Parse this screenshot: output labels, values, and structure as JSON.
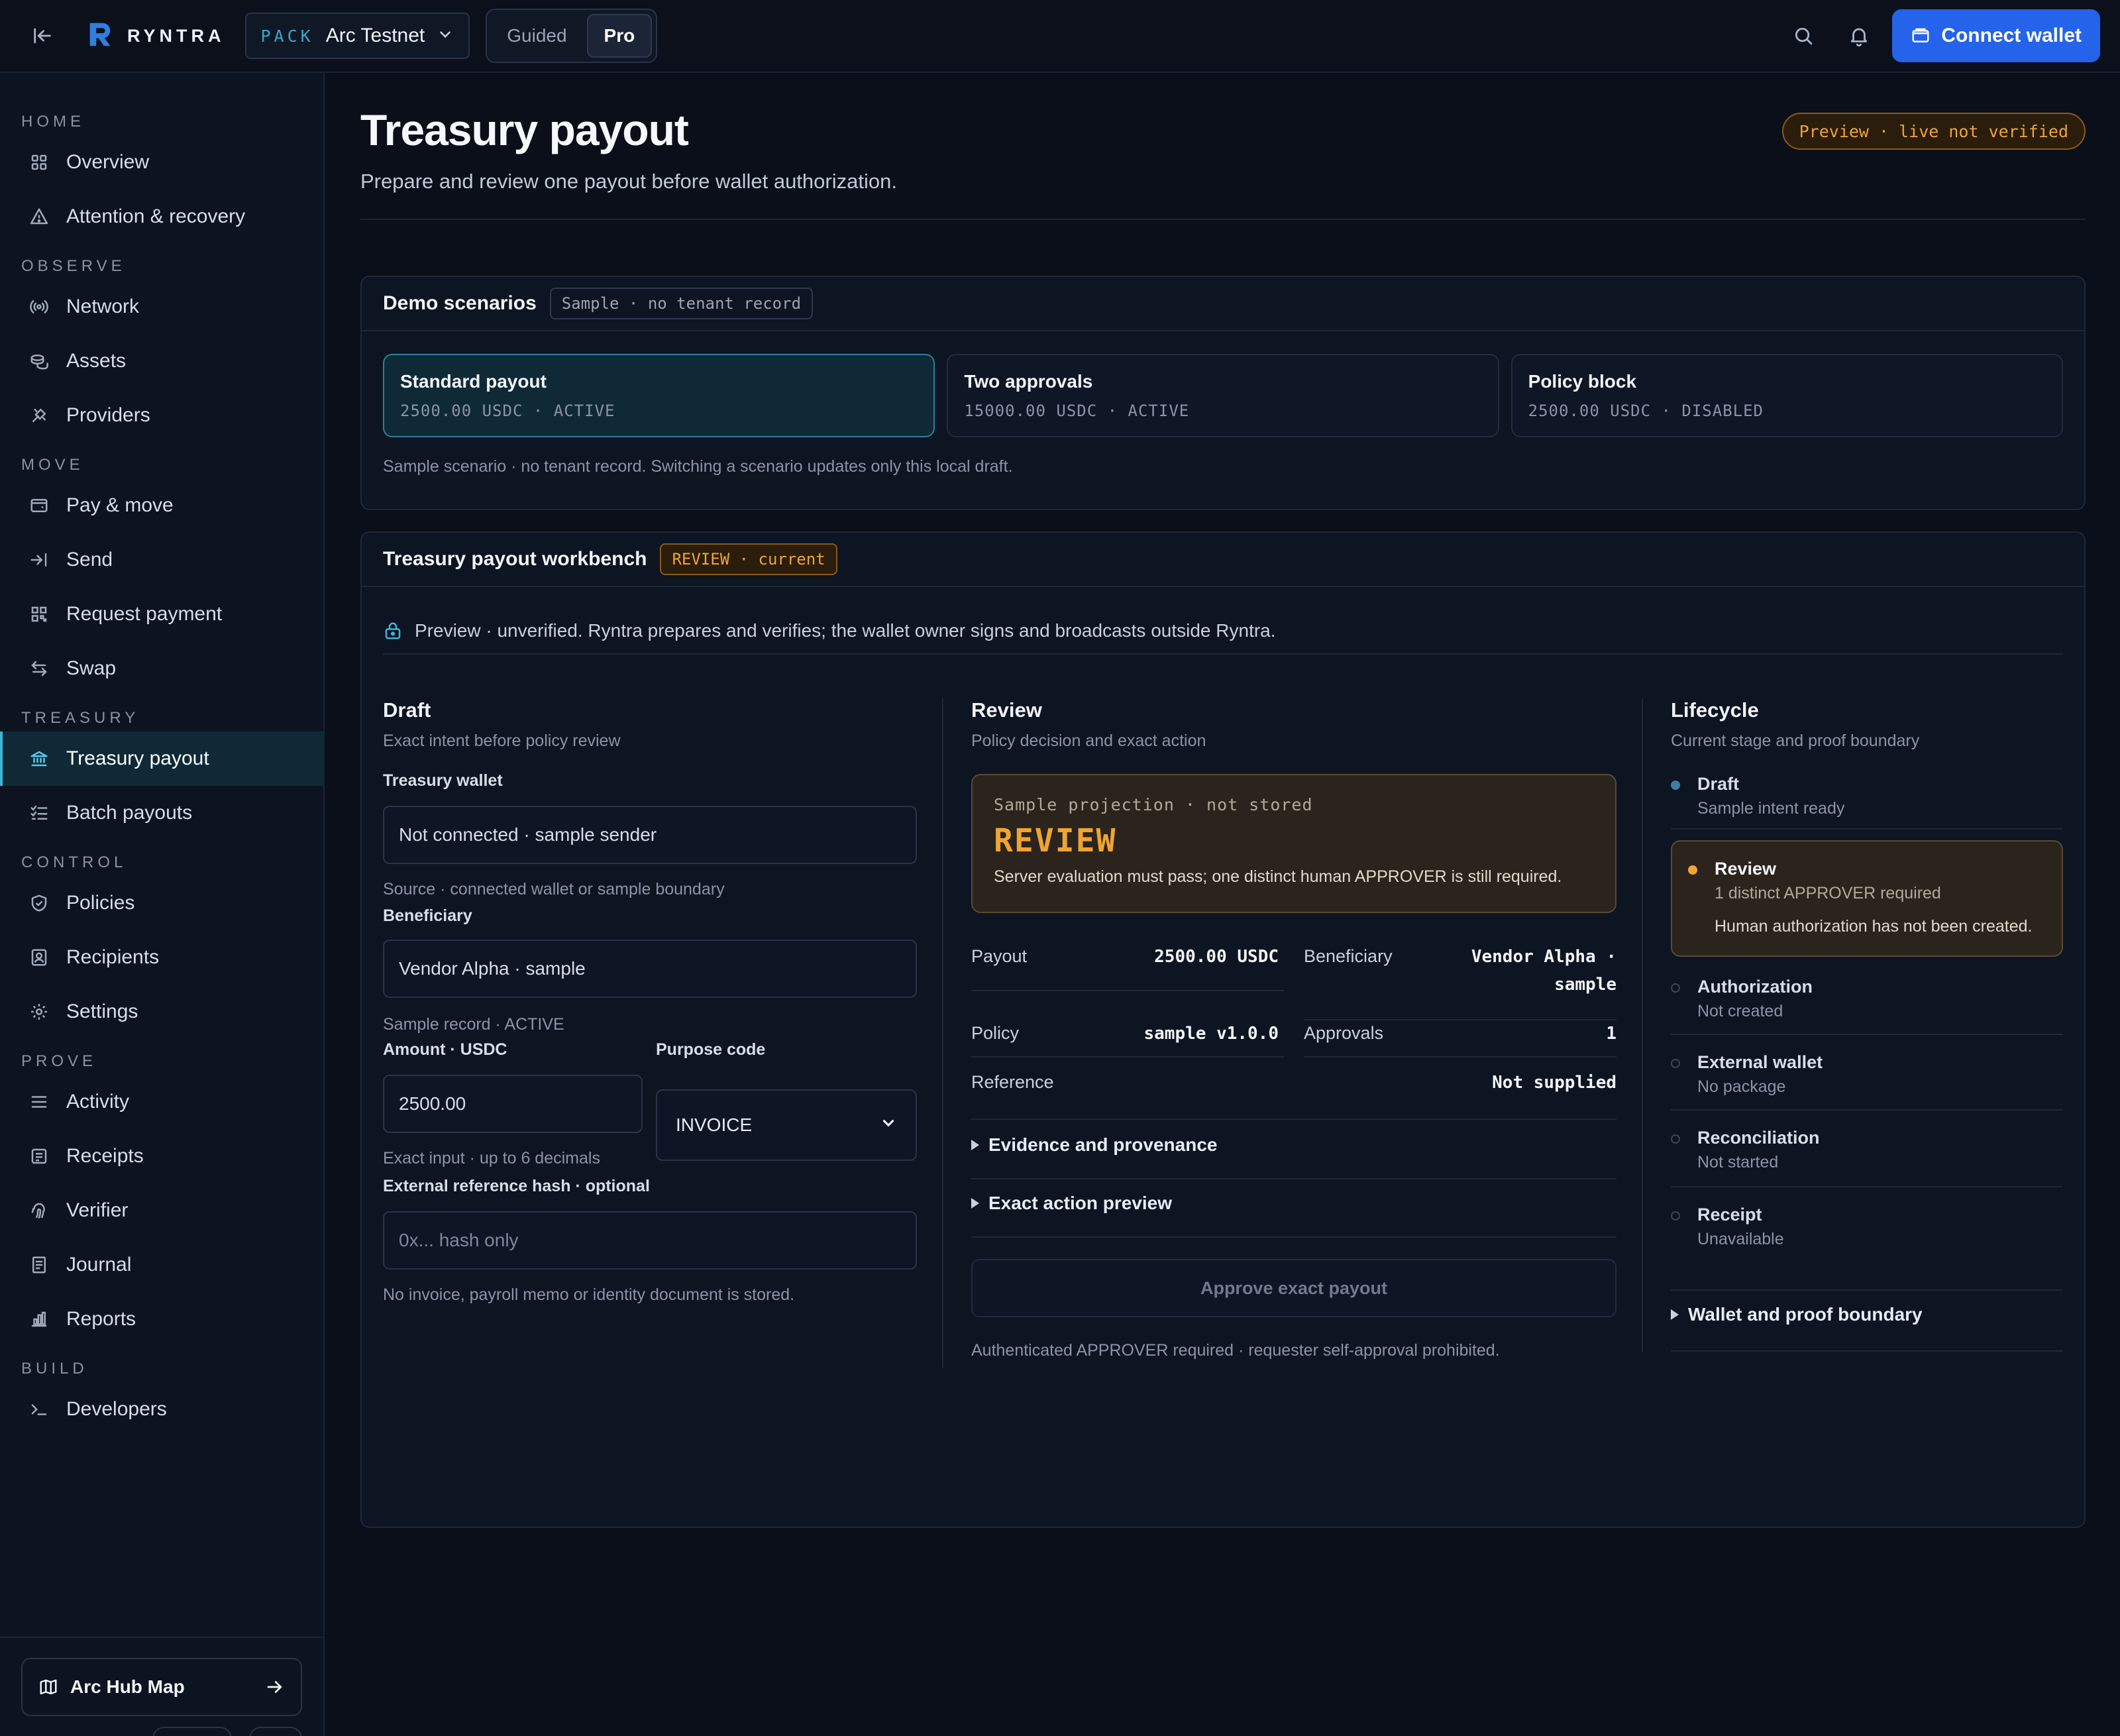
{
  "topbar": {
    "brand": "RYNTRA",
    "pack_tag": "PACK",
    "network": "Arc Testnet",
    "modes": [
      "Guided",
      "Pro"
    ],
    "active_mode": "Pro",
    "connect_label": "Connect wallet"
  },
  "sidebar": {
    "sections": [
      {
        "label": "HOME",
        "items": [
          {
            "label": "Overview",
            "icon": "grid-icon"
          },
          {
            "label": "Attention & recovery",
            "icon": "warning-icon"
          }
        ]
      },
      {
        "label": "OBSERVE",
        "items": [
          {
            "label": "Network",
            "icon": "broadcast-icon"
          },
          {
            "label": "Assets",
            "icon": "coins-icon"
          },
          {
            "label": "Providers",
            "icon": "plug-icon"
          }
        ]
      },
      {
        "label": "MOVE",
        "items": [
          {
            "label": "Pay & move",
            "icon": "wallet-icon"
          },
          {
            "label": "Send",
            "icon": "send-icon"
          },
          {
            "label": "Request payment",
            "icon": "qr-icon"
          },
          {
            "label": "Swap",
            "icon": "swap-icon"
          }
        ]
      },
      {
        "label": "TREASURY",
        "items": [
          {
            "label": "Treasury payout",
            "icon": "bank-icon",
            "active": true
          },
          {
            "label": "Batch payouts",
            "icon": "list-check-icon"
          }
        ]
      },
      {
        "label": "CONTROL",
        "items": [
          {
            "label": "Policies",
            "icon": "shield-icon"
          },
          {
            "label": "Recipients",
            "icon": "contact-icon"
          },
          {
            "label": "Settings",
            "icon": "gear-icon"
          }
        ]
      },
      {
        "label": "PROVE",
        "items": [
          {
            "label": "Activity",
            "icon": "menu-icon"
          },
          {
            "label": "Receipts",
            "icon": "receipt-icon"
          },
          {
            "label": "Verifier",
            "icon": "fingerprint-icon"
          },
          {
            "label": "Journal",
            "icon": "journal-icon"
          },
          {
            "label": "Reports",
            "icon": "chart-icon"
          }
        ]
      },
      {
        "label": "BUILD",
        "items": [
          {
            "label": "Developers",
            "icon": "terminal-icon"
          }
        ]
      }
    ],
    "hub_map": "Arc Hub Map"
  },
  "page": {
    "title": "Treasury payout",
    "subtitle": "Prepare and review one payout before wallet authorization.",
    "preview_badge": "Preview · live not verified"
  },
  "scenarios": {
    "title": "Demo scenarios",
    "chip": "Sample · no tenant record",
    "cards": [
      {
        "name": "Standard payout",
        "meta": "2500.00 USDC · ACTIVE",
        "active": true
      },
      {
        "name": "Two approvals",
        "meta": "15000.00 USDC · ACTIVE"
      },
      {
        "name": "Policy block",
        "meta": "2500.00 USDC · DISABLED"
      }
    ],
    "note": "Sample scenario · no tenant record. Switching a scenario updates only this local draft."
  },
  "workbench": {
    "title": "Treasury payout workbench",
    "chip": "REVIEW · current",
    "banner": "Preview · unverified. Ryntra prepares and verifies; the wallet owner signs and broadcasts outside Ryntra."
  },
  "draft": {
    "title": "Draft",
    "subtitle": "Exact intent before policy review",
    "wallet_label": "Treasury wallet",
    "wallet_value": "Not connected · sample sender",
    "wallet_help": "Source · connected wallet or sample boundary",
    "beneficiary_label": "Beneficiary",
    "beneficiary_value": "Vendor Alpha · sample",
    "beneficiary_help": "Sample record · ACTIVE",
    "amount_label": "Amount · USDC",
    "amount_value": "2500.00",
    "amount_help": "Exact input · up to 6 decimals",
    "purpose_label": "Purpose code",
    "purpose_value": "INVOICE",
    "ref_label": "External reference hash · optional",
    "ref_placeholder": "0x... hash only",
    "ref_help": "No invoice, payroll memo or identity document is stored."
  },
  "review": {
    "title": "Review",
    "subtitle": "Policy decision and exact action",
    "proj_label": "Sample projection · not stored",
    "proj_value": "REVIEW",
    "proj_desc": "Server evaluation must pass; one distinct human APPROVER is still required.",
    "payout_label": "Payout",
    "payout_value": "2500.00 USDC",
    "beneficiary_label": "Beneficiary",
    "beneficiary_value_1": "Vendor Alpha ·",
    "beneficiary_value_2": "sample",
    "policy_label": "Policy",
    "policy_value": "sample v1.0.0",
    "approvals_label": "Approvals",
    "approvals_value": "1",
    "reference_label": "Reference",
    "reference_value": "Not supplied",
    "evidence": "Evidence and provenance",
    "action_preview": "Exact action preview",
    "approve_label": "Approve exact payout",
    "approve_note": "Authenticated APPROVER required · requester self-approval prohibited."
  },
  "lifecycle": {
    "title": "Lifecycle",
    "subtitle": "Current stage and proof boundary",
    "draft": {
      "name": "Draft",
      "desc": "Sample intent ready"
    },
    "review": {
      "name": "Review",
      "desc": "1 distinct APPROVER required",
      "extra": "Human authorization has not been created."
    },
    "authorization": {
      "name": "Authorization",
      "desc": "Not created"
    },
    "external": {
      "name": "External wallet",
      "desc": "No package"
    },
    "reconciliation": {
      "name": "Reconciliation",
      "desc": "Not started"
    },
    "receipt": {
      "name": "Receipt",
      "desc": "Unavailable"
    },
    "boundary": "Wallet and proof boundary"
  }
}
